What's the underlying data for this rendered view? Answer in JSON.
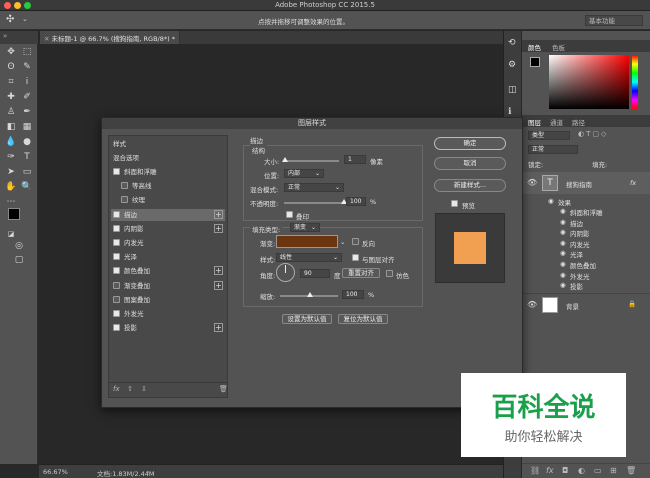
{
  "app": {
    "title": "Adobe Photoshop CC 2015.5"
  },
  "options_bar": {
    "hint": "点按并拖移可调整效果的位置。",
    "workspace": "基本功能"
  },
  "document": {
    "tab_label": "未标题-1 @ 66.7% (搜狗指南, RGB/8*) *",
    "zoom": "66.67%",
    "doc_info": "文档:1.83M/2.44M"
  },
  "right_panel": {
    "color_tabs": [
      "颜色",
      "色板"
    ],
    "layer_tabs": [
      "图层",
      "通道",
      "路径"
    ],
    "kind_filter": "类型",
    "blend_mode": "正常",
    "lock_label": "锁定:",
    "fill_label": "填充:",
    "layers": {
      "text_layer": "搜狗指南",
      "effects_label": "效果",
      "effects": [
        "斜面和浮雕",
        "描边",
        "内阴影",
        "内发光",
        "光泽",
        "颜色叠加",
        "外发光",
        "投影"
      ],
      "background": "背景"
    }
  },
  "dialog": {
    "title": "图层样式",
    "styles_header": "样式",
    "blend_options": "混合选项",
    "items": [
      {
        "label": "斜面和浮雕",
        "checked": true,
        "plus": false
      },
      {
        "label": "等高线",
        "checked": false,
        "plus": false,
        "indent": true
      },
      {
        "label": "纹理",
        "checked": false,
        "plus": false,
        "indent": true
      },
      {
        "label": "描边",
        "checked": true,
        "plus": true,
        "selected": true
      },
      {
        "label": "内阴影",
        "checked": true,
        "plus": true
      },
      {
        "label": "内发光",
        "checked": true,
        "plus": false
      },
      {
        "label": "光泽",
        "checked": true,
        "plus": false
      },
      {
        "label": "颜色叠加",
        "checked": true,
        "plus": true
      },
      {
        "label": "渐变叠加",
        "checked": false,
        "plus": true
      },
      {
        "label": "图案叠加",
        "checked": false,
        "plus": false
      },
      {
        "label": "外发光",
        "checked": true,
        "plus": false
      },
      {
        "label": "投影",
        "checked": true,
        "plus": true
      }
    ],
    "fx_label": "fx",
    "stroke": {
      "section": "描边",
      "structure": "结构",
      "size_label": "大小:",
      "size_value": "1",
      "size_unit": "像素",
      "position_label": "位置:",
      "position_value": "内部",
      "blend_label": "混合模式:",
      "blend_value": "正常",
      "opacity_label": "不透明度:",
      "opacity_value": "100",
      "opacity_unit": "%",
      "overprint": "叠印",
      "fill_type_label": "填充类型:",
      "fill_type_value": "渐变",
      "gradient_label": "渐变:",
      "gradient_color": "#6b3510",
      "reverse": "反向",
      "style_label": "样式:",
      "style_value": "线性",
      "align_layer": "与图层对齐",
      "angle_label": "角度:",
      "angle_value": "90",
      "angle_unit": "度",
      "reset_align": "重置对齐",
      "dither": "仿色",
      "scale_label": "缩放:",
      "scale_value": "100",
      "scale_unit": "%",
      "make_default": "设置为默认值",
      "reset_default": "复位为默认值"
    },
    "buttons": {
      "ok": "确定",
      "cancel": "取消",
      "new_style": "新建样式...",
      "preview": "预览"
    },
    "preview_color": "#f0a050"
  },
  "watermark": {
    "title": "百科全说",
    "subtitle": "助你轻松解决",
    "color": "#1aa04a"
  }
}
